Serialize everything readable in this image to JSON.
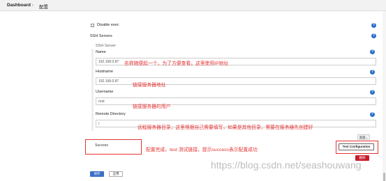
{
  "breadcrumb": {
    "dashboard": "Dashboard",
    "separator": "›",
    "current": "配置"
  },
  "disable_exec": {
    "label": "Disable exec"
  },
  "ssh_servers": {
    "section_title": "SSH Servers",
    "server_label": "SSH Server",
    "name": {
      "label": "Name",
      "value": "192.168.0.87"
    },
    "hostname": {
      "label": "Hostname",
      "value": "192.168.0.87"
    },
    "username": {
      "label": "Username",
      "value": "root"
    },
    "remote_directory": {
      "label": "Remote Directory",
      "value": "/"
    }
  },
  "annotations": {
    "name": "名称随便起一个，为了方便查看，这里使用IP地址",
    "hostname": "链接服务器地址",
    "username": "链接服务器的用户",
    "remote_directory": "远程服务器目录，这里根据自己需要填写，如果是其他目录，需要在服务器先创建好",
    "test": "配置完成，test 测试链接，提示success表示配置成功"
  },
  "status": {
    "text": "Success"
  },
  "buttons": {
    "advanced": "高级...",
    "test_configuration": "Test Configuration",
    "delete": "删除",
    "save": "保存",
    "apply": "应用"
  },
  "help_icon": "?",
  "watermark": "https://blog.csdn.net/seashouwang",
  "colors": {
    "annotation": "#e53333",
    "help": "#2c6ec8",
    "delete": "#c81c2c",
    "save": "#3b6fc9"
  }
}
